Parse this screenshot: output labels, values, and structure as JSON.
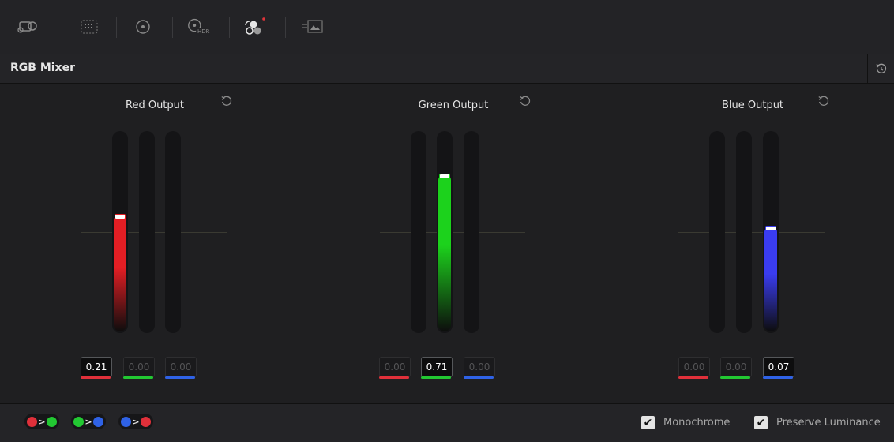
{
  "toolbar": {
    "icons": [
      "camera-raw-icon",
      "color-match-icon",
      "color-wheels-icon",
      "hdr-wheels-icon",
      "rgb-mixer-icon",
      "motion-effects-icon"
    ],
    "hdr_label": "HDR",
    "active_indicator_color": "#e0343a"
  },
  "panel": {
    "title": "RGB Mixer"
  },
  "colors": {
    "red": "#e0303a",
    "green": "#22c832",
    "blue": "#2f62e6"
  },
  "outputs": [
    {
      "title": "Red Output",
      "fill_color": "#e41e24",
      "active_channel": 0,
      "channels": [
        {
          "channel": "red",
          "value": "0.21",
          "level": 0.21
        },
        {
          "channel": "green",
          "value": "0.00",
          "level": 0
        },
        {
          "channel": "blue",
          "value": "0.00",
          "level": 0
        }
      ]
    },
    {
      "title": "Green Output",
      "fill_color": "#1cd21c",
      "active_channel": 1,
      "channels": [
        {
          "channel": "red",
          "value": "0.00",
          "level": 0
        },
        {
          "channel": "green",
          "value": "0.71",
          "level": 0.71
        },
        {
          "channel": "blue",
          "value": "0.00",
          "level": 0
        }
      ]
    },
    {
      "title": "Blue Output",
      "fill_color": "#3a3cf0",
      "active_channel": 2,
      "channels": [
        {
          "channel": "red",
          "value": "0.00",
          "level": 0
        },
        {
          "channel": "green",
          "value": "0.00",
          "level": 0
        },
        {
          "channel": "blue",
          "value": "0.07",
          "level": 0.07
        }
      ]
    }
  ],
  "footer": {
    "swap_buttons": [
      {
        "name": "swap-red-green",
        "from": "red",
        "to": "green"
      },
      {
        "name": "swap-green-blue",
        "from": "green",
        "to": "blue"
      },
      {
        "name": "swap-blue-red",
        "from": "blue",
        "to": "red"
      }
    ],
    "arrow_glyph": ">",
    "monochrome": {
      "label": "Monochrome",
      "checked": true
    },
    "preserve_luminance": {
      "label": "Preserve Luminance",
      "checked": true
    }
  }
}
